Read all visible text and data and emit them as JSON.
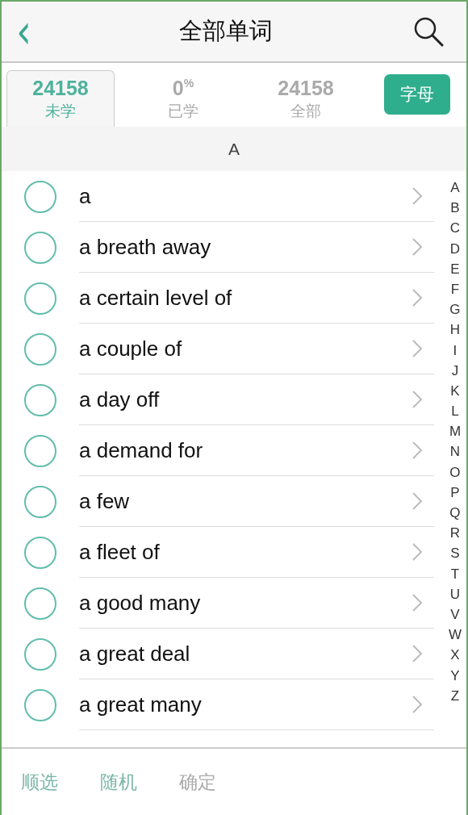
{
  "header": {
    "back": "‹",
    "title": "全部单词"
  },
  "tabs": [
    {
      "count": "24158",
      "label": "未学",
      "selected": true
    },
    {
      "count": "0",
      "suffix": "%",
      "label": "已学",
      "selected": false
    },
    {
      "count": "24158",
      "label": "全部",
      "selected": false
    }
  ],
  "letter_button": "字母",
  "section": "A",
  "words": [
    {
      "text": "a",
      "checked": false
    },
    {
      "text": "a breath away",
      "checked": false
    },
    {
      "text": "a certain level of",
      "checked": false
    },
    {
      "text": "a couple of",
      "checked": false
    },
    {
      "text": "a day off",
      "checked": false
    },
    {
      "text": "a demand for",
      "checked": false
    },
    {
      "text": "a few",
      "checked": false
    },
    {
      "text": "a fleet of",
      "checked": false
    },
    {
      "text": "a good many",
      "checked": false
    },
    {
      "text": "a great deal",
      "checked": false
    },
    {
      "text": "a great many",
      "checked": false
    }
  ],
  "index": [
    "A",
    "B",
    "C",
    "D",
    "E",
    "F",
    "G",
    "H",
    "I",
    "J",
    "K",
    "L",
    "M",
    "N",
    "O",
    "P",
    "Q",
    "R",
    "S",
    "T",
    "U",
    "V",
    "W",
    "X",
    "Y",
    "Z"
  ],
  "bottom_actions": [
    {
      "label": "顺选",
      "disabled": false
    },
    {
      "label": "随机",
      "disabled": false
    },
    {
      "label": "确定",
      "disabled": true
    }
  ]
}
